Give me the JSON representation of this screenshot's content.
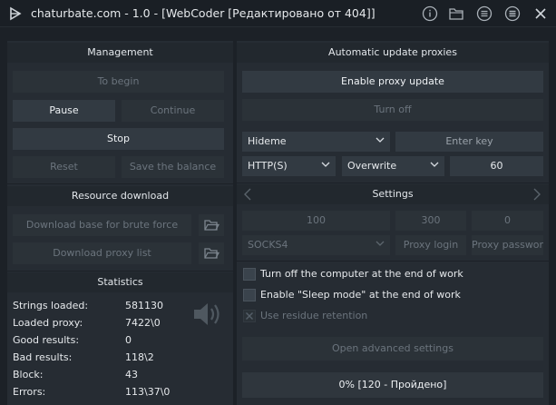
{
  "window": {
    "title": "chaturbate.com - 1.0 - [WebCoder [Редактировано от 404]]"
  },
  "titlebar_icons": [
    "info-icon",
    "folder-icon",
    "list-icon",
    "menu-icon",
    "close-icon"
  ],
  "management": {
    "header": "Management",
    "to_begin": "To begin",
    "pause": "Pause",
    "continue": "Continue",
    "stop": "Stop",
    "reset": "Reset",
    "save_balance": "Save the balance"
  },
  "resource": {
    "header": "Resource download",
    "download_base": "Download base for brute force",
    "download_proxy": "Download proxy list"
  },
  "statistics": {
    "header": "Statistics",
    "rows": [
      {
        "label": "Strings loaded:",
        "value": "581130"
      },
      {
        "label": "Loaded proxy:",
        "value": "7422\\0"
      },
      {
        "label": "Good results:",
        "value": "0"
      },
      {
        "label": "Bad results:",
        "value": "118\\2"
      },
      {
        "label": "Block:",
        "value": "43"
      },
      {
        "label": "Errors:",
        "value": "113\\37\\0"
      }
    ]
  },
  "proxies": {
    "header": "Automatic update proxies",
    "enable_update": "Enable proxy update",
    "turn_off": "Turn off",
    "source": "Hideme",
    "key_placeholder": "Enter key",
    "protocol": "HTTP(S)",
    "mode": "Overwrite",
    "interval": "60"
  },
  "settings": {
    "header": "Settings",
    "value1": "100",
    "value2": "300",
    "value3": "0",
    "proxy_type": "SOCKS4",
    "proxy_login": "Proxy login",
    "proxy_password": "Proxy password"
  },
  "options": {
    "turn_off_computer": "Turn off the computer at the end of work",
    "sleep_mode": "Enable \"Sleep mode\" at the end of work",
    "residue": "Use residue retention",
    "advanced": "Open advanced settings"
  },
  "progress": {
    "label": "0% [120 - Пройдено]",
    "fraction": 0
  },
  "colors": {
    "bg": "#1c2127",
    "panel": "#262c33",
    "button": "#323a42",
    "disabled_text": "#6b747d"
  }
}
